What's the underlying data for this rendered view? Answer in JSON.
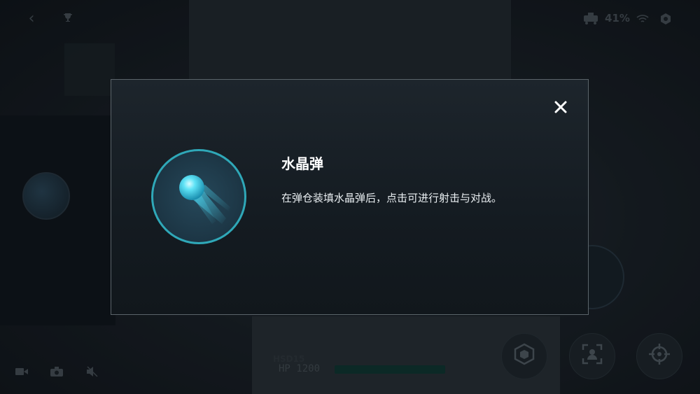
{
  "status_bar": {
    "battery": "41%"
  },
  "hud": {
    "hp_text": "HP 1200",
    "hp_fraction": 0.0,
    "robot_id": "HSD15"
  },
  "modal": {
    "title": "水晶弹",
    "description": "在弹仓装填水晶弹后，点击可进行射击与对战。"
  },
  "icons": {
    "back": "chevron-left",
    "trophy": "trophy",
    "robot": "robot",
    "wifi": "wifi",
    "settings": "hexagon-settings",
    "video": "video-camera",
    "camera": "camera",
    "mute": "speaker-muted",
    "cube": "cube",
    "scan": "face-scan",
    "target": "crosshair",
    "close": "close-x",
    "ball": "crystal-ball"
  },
  "colors": {
    "accent": "#2fa8b8",
    "hp_bar": "#0f3a32"
  }
}
